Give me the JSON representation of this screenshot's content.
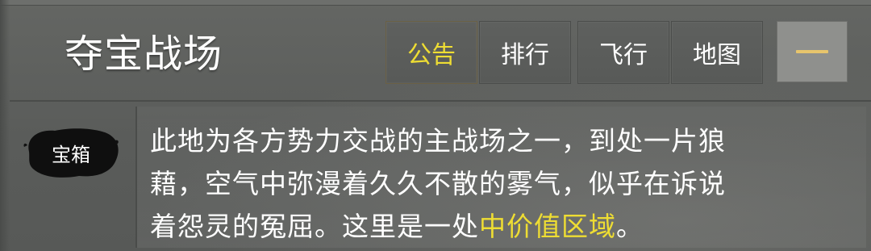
{
  "header": {
    "title": "夺宝战场",
    "tabs": [
      {
        "label": "公告",
        "active": true
      },
      {
        "label": "排行",
        "active": false
      },
      {
        "label": "飞行",
        "active": false
      },
      {
        "label": "地图",
        "active": false
      }
    ],
    "minimize_icon": "minus-icon"
  },
  "body": {
    "badge_label": "宝箱",
    "description_line1": "此地为各方势力交战的主战场之一，到处一片狼",
    "description_line2": "藉，空气中弥漫着久久不散的雾气，似乎在诉说",
    "description_line3_prefix": "着怨灵的冤屈。这里是一处",
    "description_line3_highlight": "中价值区域",
    "description_line3_suffix": "。"
  },
  "colors": {
    "highlight": "#eedd33",
    "text": "#ffffff",
    "panel": "#5b5d5b",
    "minimize_bg": "#8f908d",
    "minimize_dash": "#e7c56c"
  }
}
